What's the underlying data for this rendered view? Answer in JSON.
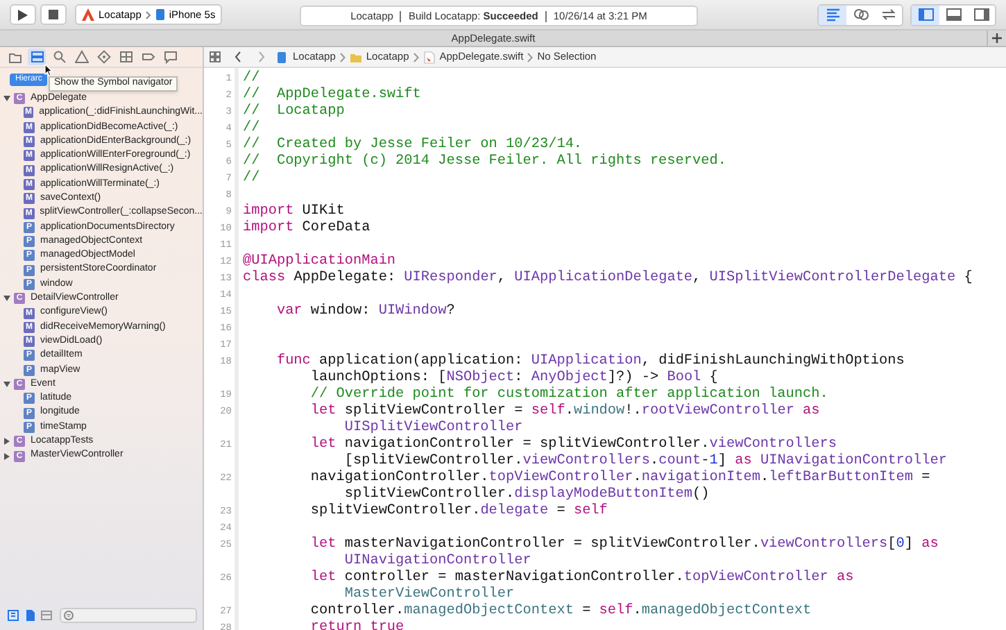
{
  "toolbar": {
    "scheme": {
      "project": "Locatapp",
      "device": "iPhone 5s"
    },
    "activity": {
      "project": "Locatapp",
      "status": "Build Locatapp: **Succeeded**",
      "time": "10/26/14 at 3:21 PM"
    },
    "editor_modes": [
      {
        "kind": "standard",
        "selected": true
      },
      {
        "kind": "assistant",
        "selected": false
      },
      {
        "kind": "version",
        "selected": false
      }
    ],
    "panels": [
      {
        "kind": "navigator",
        "selected": true
      },
      {
        "kind": "debug",
        "selected": false
      },
      {
        "kind": "utilities",
        "selected": false
      }
    ]
  },
  "tab": {
    "title": "AppDelegate.swift"
  },
  "navigator": {
    "tabs": [
      {
        "kind": "folder",
        "selected": false
      },
      {
        "kind": "symbol",
        "selected": true
      },
      {
        "kind": "search",
        "selected": false
      },
      {
        "kind": "issue",
        "selected": false
      },
      {
        "kind": "test",
        "selected": false
      },
      {
        "kind": "debug",
        "selected": false
      },
      {
        "kind": "breakpoint",
        "selected": false
      },
      {
        "kind": "report",
        "selected": false
      }
    ],
    "mode_button": "Hierarc",
    "tooltip": "Show the Symbol navigator",
    "tree": [
      {
        "kind": "class",
        "badge": "C",
        "name": "AppDelegate",
        "expanded": true,
        "children": [
          {
            "kind": "method",
            "badge": "M",
            "name": "application(_:didFinishLaunchingWit..."
          },
          {
            "kind": "method",
            "badge": "M",
            "name": "applicationDidBecomeActive(_:)"
          },
          {
            "kind": "method",
            "badge": "M",
            "name": "applicationDidEnterBackground(_:)"
          },
          {
            "kind": "method",
            "badge": "M",
            "name": "applicationWillEnterForeground(_:)"
          },
          {
            "kind": "method",
            "badge": "M",
            "name": "applicationWillResignActive(_:)"
          },
          {
            "kind": "method",
            "badge": "M",
            "name": "applicationWillTerminate(_:)"
          },
          {
            "kind": "method",
            "badge": "M",
            "name": "saveContext()"
          },
          {
            "kind": "method",
            "badge": "M",
            "name": "splitViewController(_:collapseSecon..."
          },
          {
            "kind": "property",
            "badge": "P",
            "name": "applicationDocumentsDirectory"
          },
          {
            "kind": "property",
            "badge": "P",
            "name": "managedObjectContext"
          },
          {
            "kind": "property",
            "badge": "P",
            "name": "managedObjectModel"
          },
          {
            "kind": "property",
            "badge": "P",
            "name": "persistentStoreCoordinator"
          },
          {
            "kind": "property",
            "badge": "P",
            "name": "window"
          }
        ]
      },
      {
        "kind": "class",
        "badge": "C",
        "name": "DetailViewController",
        "expanded": true,
        "children": [
          {
            "kind": "method",
            "badge": "M",
            "name": "configureView()"
          },
          {
            "kind": "method",
            "badge": "M",
            "name": "didReceiveMemoryWarning()"
          },
          {
            "kind": "method",
            "badge": "M",
            "name": "viewDidLoad()"
          },
          {
            "kind": "property",
            "badge": "P",
            "name": "detailItem"
          },
          {
            "kind": "property",
            "badge": "P",
            "name": "mapView"
          }
        ]
      },
      {
        "kind": "class",
        "badge": "C",
        "name": "Event",
        "expanded": true,
        "children": [
          {
            "kind": "property",
            "badge": "P",
            "name": "latitude"
          },
          {
            "kind": "property",
            "badge": "P",
            "name": "longitude"
          },
          {
            "kind": "property",
            "badge": "P",
            "name": "timeStamp"
          }
        ]
      },
      {
        "kind": "class",
        "badge": "C",
        "name": "LocatappTests",
        "expanded": false
      },
      {
        "kind": "class",
        "badge": "C",
        "name": "MasterViewController",
        "expanded": false
      }
    ],
    "bottom_buttons": [
      {
        "kind": "hierarchy",
        "selected": true
      },
      {
        "kind": "file",
        "selected": true
      },
      {
        "kind": "box",
        "selected": false
      }
    ]
  },
  "jump_bar": [
    {
      "kind": "project",
      "text": "Locatapp"
    },
    {
      "kind": "folder",
      "text": "Locatapp"
    },
    {
      "kind": "swift",
      "text": "AppDelegate.swift"
    },
    {
      "kind": "plain",
      "text": "No Selection"
    }
  ],
  "code": [
    {
      "number": "1",
      "tokens": [
        {
          "kind": "comment",
          "text": "//"
        }
      ]
    },
    {
      "number": "2",
      "tokens": [
        {
          "kind": "comment",
          "text": "//  AppDelegate.swift"
        }
      ]
    },
    {
      "number": "3",
      "tokens": [
        {
          "kind": "comment",
          "text": "//  Locatapp"
        }
      ]
    },
    {
      "number": "4",
      "tokens": [
        {
          "kind": "comment",
          "text": "//"
        }
      ]
    },
    {
      "number": "5",
      "tokens": [
        {
          "kind": "comment",
          "text": "//  Created by Jesse Feiler on 10/23/14."
        }
      ]
    },
    {
      "number": "6",
      "tokens": [
        {
          "kind": "comment",
          "text": "//  Copyright (c) 2014 Jesse Feiler. All rights reserved."
        }
      ]
    },
    {
      "number": "7",
      "tokens": [
        {
          "kind": "comment",
          "text": "//"
        }
      ]
    },
    {
      "number": "8"
    },
    {
      "number": "9",
      "tokens": [
        {
          "kind": "keyword",
          "text": "import"
        },
        {
          "kind": "plain",
          "text": " UIKit"
        }
      ]
    },
    {
      "number": "10",
      "tokens": [
        {
          "kind": "keyword",
          "text": "import"
        },
        {
          "kind": "plain",
          "text": " CoreData"
        }
      ]
    },
    {
      "number": "11"
    },
    {
      "number": "12",
      "tokens": [
        {
          "kind": "keyword",
          "text": "@UIApplicationMain"
        }
      ]
    },
    {
      "number": "13",
      "tokens": [
        {
          "kind": "keyword",
          "text": "class"
        },
        {
          "kind": "plain",
          "text": " AppDelegate: "
        },
        {
          "kind": "system",
          "text": "UIResponder"
        },
        {
          "kind": "plain",
          "text": ", "
        },
        {
          "kind": "system",
          "text": "UIApplicationDelegate"
        },
        {
          "kind": "plain",
          "text": ", "
        },
        {
          "kind": "system",
          "text": "UISplitViewControllerDelegate"
        },
        {
          "kind": "plain",
          "text": " {"
        }
      ]
    },
    {
      "number": "14"
    },
    {
      "number": "15",
      "tokens": [
        {
          "kind": "keyword",
          "text": "    var"
        },
        {
          "kind": "plain",
          "text": " window: "
        },
        {
          "kind": "system",
          "text": "UIWindow"
        },
        {
          "kind": "plain",
          "text": "?"
        }
      ]
    },
    {
      "number": "16"
    },
    {
      "number": "17"
    },
    {
      "number": "18",
      "tokens": [
        {
          "kind": "keyword",
          "text": "    func"
        },
        {
          "kind": "plain",
          "text": " application(application: "
        },
        {
          "kind": "system",
          "text": "UIApplication"
        },
        {
          "kind": "plain",
          "text": ", didFinishLaunchingWithOptions"
        }
      ]
    },
    {
      "tokens": [
        {
          "kind": "plain",
          "text": "        launchOptions: ["
        },
        {
          "kind": "system",
          "text": "NSObject"
        },
        {
          "kind": "plain",
          "text": ": "
        },
        {
          "kind": "system",
          "text": "AnyObject"
        },
        {
          "kind": "plain",
          "text": "]?) -> "
        },
        {
          "kind": "system",
          "text": "Bool"
        },
        {
          "kind": "plain",
          "text": " {"
        }
      ]
    },
    {
      "number": "19",
      "tokens": [
        {
          "kind": "comment",
          "text": "        // Override point for customization after application launch."
        }
      ]
    },
    {
      "number": "20",
      "tokens": [
        {
          "kind": "keyword",
          "text": "        let"
        },
        {
          "kind": "plain",
          "text": " splitViewController = "
        },
        {
          "kind": "keyword",
          "text": "self"
        },
        {
          "kind": "plain",
          "text": "."
        },
        {
          "kind": "project",
          "text": "window"
        },
        {
          "kind": "plain",
          "text": "!."
        },
        {
          "kind": "system",
          "text": "rootViewController"
        },
        {
          "kind": "keyword",
          "text": " as"
        }
      ]
    },
    {
      "tokens": [
        {
          "kind": "system",
          "text": "            UISplitViewController"
        }
      ]
    },
    {
      "number": "21",
      "tokens": [
        {
          "kind": "keyword",
          "text": "        let"
        },
        {
          "kind": "plain",
          "text": " navigationController = splitViewController."
        },
        {
          "kind": "system",
          "text": "viewControllers"
        }
      ]
    },
    {
      "tokens": [
        {
          "kind": "plain",
          "text": "            [splitViewController."
        },
        {
          "kind": "system",
          "text": "viewControllers"
        },
        {
          "kind": "plain",
          "text": "."
        },
        {
          "kind": "system",
          "text": "count"
        },
        {
          "kind": "plain",
          "text": "-"
        },
        {
          "kind": "number",
          "text": "1"
        },
        {
          "kind": "plain",
          "text": "] "
        },
        {
          "kind": "keyword",
          "text": "as"
        },
        {
          "kind": "system",
          "text": " UINavigationController"
        }
      ]
    },
    {
      "number": "22",
      "tokens": [
        {
          "kind": "plain",
          "text": "        navigationController."
        },
        {
          "kind": "system",
          "text": "topViewController"
        },
        {
          "kind": "plain",
          "text": "."
        },
        {
          "kind": "system",
          "text": "navigationItem"
        },
        {
          "kind": "plain",
          "text": "."
        },
        {
          "kind": "system",
          "text": "leftBarButtonItem"
        },
        {
          "kind": "plain",
          "text": " ="
        }
      ]
    },
    {
      "tokens": [
        {
          "kind": "plain",
          "text": "            splitViewController."
        },
        {
          "kind": "system",
          "text": "displayModeButtonItem"
        },
        {
          "kind": "plain",
          "text": "()"
        }
      ]
    },
    {
      "number": "23",
      "tokens": [
        {
          "kind": "plain",
          "text": "        splitViewController."
        },
        {
          "kind": "system",
          "text": "delegate"
        },
        {
          "kind": "plain",
          "text": " = "
        },
        {
          "kind": "keyword",
          "text": "self"
        }
      ]
    },
    {
      "number": "24"
    },
    {
      "number": "25",
      "tokens": [
        {
          "kind": "keyword",
          "text": "        let"
        },
        {
          "kind": "plain",
          "text": " masterNavigationController = splitViewController."
        },
        {
          "kind": "system",
          "text": "viewControllers"
        },
        {
          "kind": "plain",
          "text": "["
        },
        {
          "kind": "number",
          "text": "0"
        },
        {
          "kind": "plain",
          "text": "] "
        },
        {
          "kind": "keyword",
          "text": "as"
        }
      ]
    },
    {
      "tokens": [
        {
          "kind": "system",
          "text": "            UINavigationController"
        }
      ]
    },
    {
      "number": "26",
      "tokens": [
        {
          "kind": "keyword",
          "text": "        let"
        },
        {
          "kind": "plain",
          "text": " controller = masterNavigationController."
        },
        {
          "kind": "system",
          "text": "topViewController"
        },
        {
          "kind": "keyword",
          "text": " as"
        }
      ]
    },
    {
      "tokens": [
        {
          "kind": "project",
          "text": "            MasterViewController"
        }
      ]
    },
    {
      "number": "27",
      "tokens": [
        {
          "kind": "plain",
          "text": "        controller."
        },
        {
          "kind": "project",
          "text": "managedObjectContext"
        },
        {
          "kind": "plain",
          "text": " = "
        },
        {
          "kind": "keyword",
          "text": "self"
        },
        {
          "kind": "plain",
          "text": "."
        },
        {
          "kind": "project",
          "text": "managedObjectContext"
        }
      ]
    },
    {
      "number": "28",
      "tokens": [
        {
          "kind": "keyword",
          "text": "        return"
        },
        {
          "kind": "keyword",
          "text": " true"
        }
      ]
    }
  ]
}
